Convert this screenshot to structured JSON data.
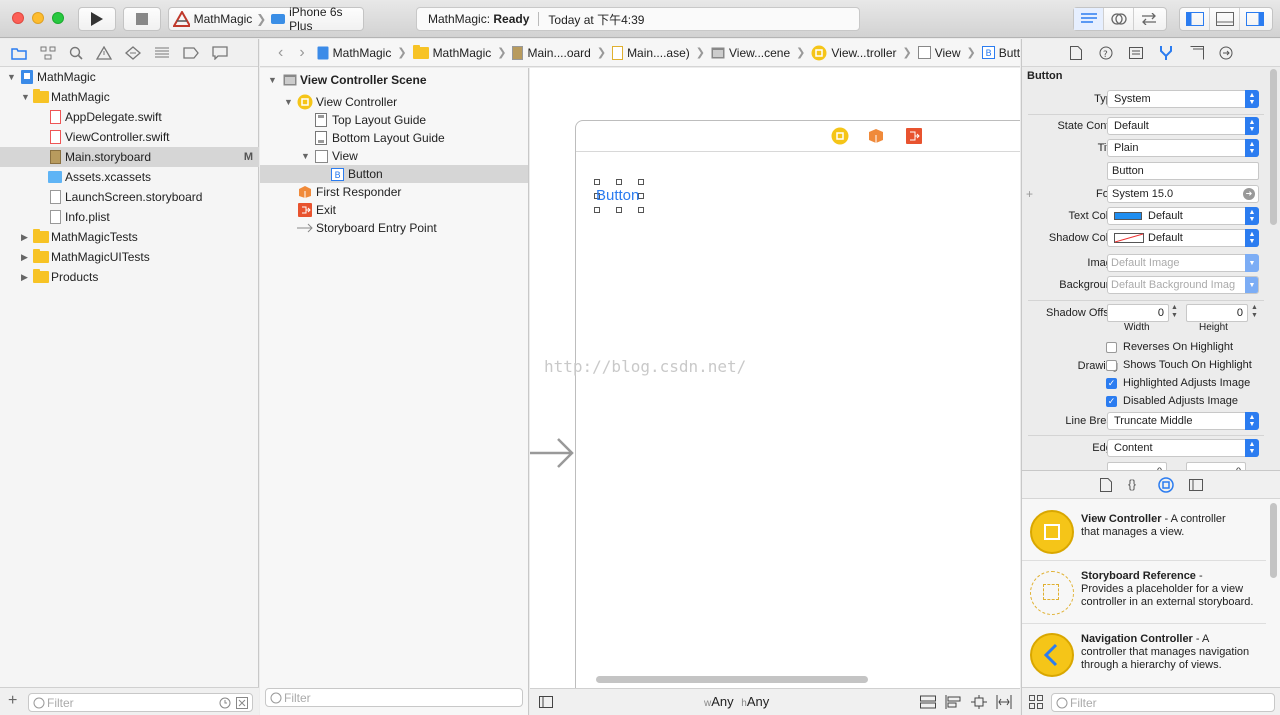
{
  "toolbar": {
    "scheme_target": "MathMagic",
    "scheme_device": "iPhone 6s Plus",
    "status_app": "MathMagic:",
    "status_state": "Ready",
    "status_time": "Today at 下午4:39"
  },
  "navigator": {
    "items": [
      {
        "label": "MathMagic",
        "type": "project"
      },
      {
        "label": "MathMagic",
        "type": "folder"
      },
      {
        "label": "AppDelegate.swift",
        "type": "swift"
      },
      {
        "label": "ViewController.swift",
        "type": "swift"
      },
      {
        "label": "Main.storyboard",
        "type": "storyboard",
        "badge": "M"
      },
      {
        "label": "Assets.xcassets",
        "type": "assets"
      },
      {
        "label": "LaunchScreen.storyboard",
        "type": "storyboard"
      },
      {
        "label": "Info.plist",
        "type": "plist"
      },
      {
        "label": "MathMagicTests",
        "type": "folder"
      },
      {
        "label": "MathMagicUITests",
        "type": "folder"
      },
      {
        "label": "Products",
        "type": "folder"
      }
    ],
    "filter_placeholder": "Filter"
  },
  "jumpbar": {
    "crumbs": [
      "MathMagic",
      "MathMagic",
      "Main....oard",
      "Main....ase)",
      "View...cene",
      "View...troller",
      "View",
      "Button"
    ]
  },
  "outline": {
    "items": [
      "View Controller Scene",
      "View Controller",
      "Top Layout Guide",
      "Bottom Layout Guide",
      "View",
      "Button",
      "First Responder",
      "Exit",
      "Storyboard Entry Point"
    ],
    "filter_placeholder": "Filter"
  },
  "canvas": {
    "button_title": "Button",
    "watermark": "http://blog.csdn.net/",
    "size_w_prefix": "w",
    "size_w": "Any",
    "size_h_prefix": "h",
    "size_h": "Any"
  },
  "inspector": {
    "section_title": "Button",
    "type_label": "Type",
    "type_value": "System",
    "state_label": "State Config",
    "state_value": "Default",
    "title_label": "Title",
    "title_value": "Plain",
    "title_text": "Button",
    "font_label": "Font",
    "font_value": "System 15.0",
    "text_color_label": "Text Color",
    "text_color_value": "Default",
    "shadow_color_label": "Shadow Color",
    "shadow_color_value": "Default",
    "image_label": "Image",
    "image_placeholder": "Default Image",
    "background_label": "Background",
    "background_placeholder": "Default Background Imag",
    "shadow_offset_label": "Shadow Offset",
    "shadow_w": "0",
    "shadow_h": "0",
    "width_label": "Width",
    "height_label": "Height",
    "reverses_label": "Reverses On Highlight",
    "drawing_label": "Drawing",
    "shows_touch_label": "Shows Touch On Highlight",
    "highlighted_label": "Highlighted Adjusts Image",
    "disabled_label": "Disabled Adjusts Image",
    "line_break_label": "Line Break",
    "line_break_value": "Truncate Middle",
    "edge_label": "Edge",
    "edge_value": "Content",
    "inset_w": "0",
    "inset_h": "0"
  },
  "library": {
    "items": [
      {
        "title": "View Controller",
        "desc1": " - A controller",
        "desc2": "that manages a view."
      },
      {
        "title": "Storyboard Reference",
        "desc1": " -",
        "desc2": "Provides a placeholder for a view",
        "desc3": "controller in an external storyboard."
      },
      {
        "title": "Navigation Controller",
        "desc1": " - A",
        "desc2": "controller that manages navigation",
        "desc3": "through a hierarchy of views."
      }
    ],
    "filter_placeholder": "Filter"
  },
  "colors": {
    "accent": "#2b7cf0",
    "folder": "#f7c325",
    "scene_icon": "#f5c518",
    "responder": "#f08a3a"
  }
}
